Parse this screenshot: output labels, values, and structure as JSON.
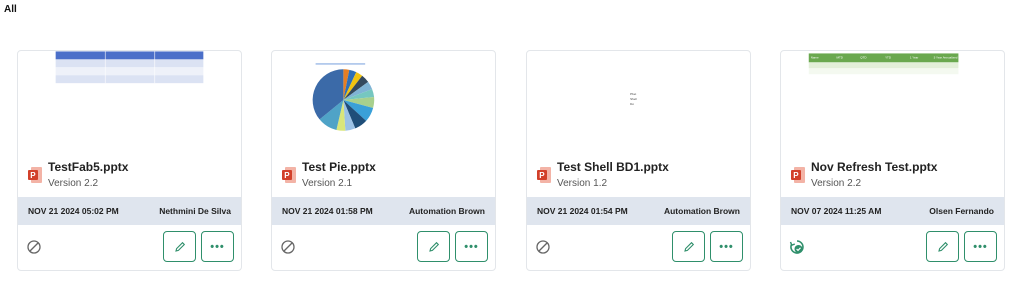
{
  "section": {
    "label": "All"
  },
  "cards": [
    {
      "file_name": "TestFab5.pptx",
      "version": "Version 2.2",
      "date": "NOV 21 2024 05:02 PM",
      "author": "Nethmini De Silva",
      "status_icon": "disabled-circle-icon"
    },
    {
      "file_name": "Test Pie.pptx",
      "version": "Version 2.1",
      "date": "NOV 21 2024 01:58 PM",
      "author": "Automation Brown",
      "status_icon": "disabled-circle-icon"
    },
    {
      "file_name": "Test Shell BD1.pptx",
      "version": "Version 1.2",
      "date": "NOV 21 2024 01:54 PM",
      "author": "Automation Brown",
      "status_icon": "disabled-circle-icon"
    },
    {
      "file_name": "Nov Refresh Test.pptx",
      "version": "Version 2.2",
      "date": "NOV 07 2024 11:25 AM",
      "author": "Olsen Fernando",
      "status_icon": "refresh-check-icon"
    }
  ],
  "thumb3_text": [
    "Pbet",
    "Shell",
    "Do"
  ],
  "thumb4_headers": [
    "Name",
    "MTD",
    "QTD",
    "YTD",
    "1 Year",
    "3 Year Annualized"
  ],
  "colors": {
    "accent": "#2f8f6b",
    "meta_bar": "#dfe5ee",
    "ppt_red": "#d2402a"
  },
  "icons": {
    "edit": "pencil-icon",
    "more": "more-dots-icon",
    "file": "powerpoint-file-icon"
  }
}
